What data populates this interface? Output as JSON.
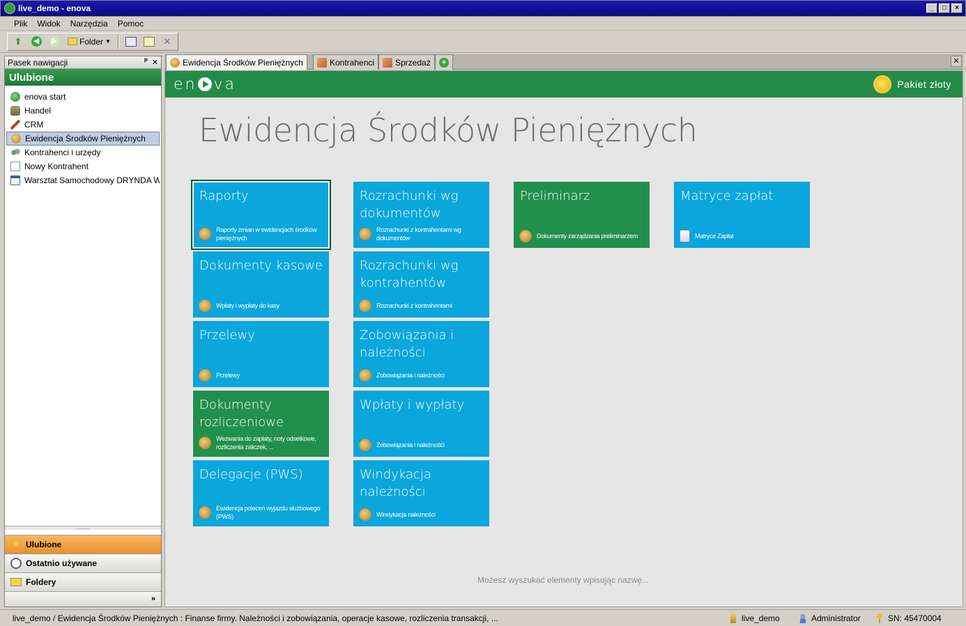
{
  "window": {
    "title": "live_demo - enova"
  },
  "menu": [
    "Plik",
    "Widok",
    "Narzędzia",
    "Pomoc"
  ],
  "toolbar": {
    "folder_label": "Folder"
  },
  "nav": {
    "header": "Pasek nawigacji",
    "title": "Ulubione",
    "items": [
      {
        "label": "enova start",
        "icon": "enova-globe-icon"
      },
      {
        "label": "Handel",
        "icon": "stack-icon"
      },
      {
        "label": "CRM",
        "icon": "phone-icon"
      },
      {
        "label": "Ewidencja Środków Pieniężnych",
        "icon": "coin-icon",
        "selected": true
      },
      {
        "label": "Kontrahenci i urzędy",
        "icon": "people-icon"
      },
      {
        "label": "Nowy Kontrahent",
        "icon": "document-icon"
      },
      {
        "label": "Warsztat Samochodowy DRYNDA Wi...",
        "icon": "window-icon"
      }
    ],
    "bottom": [
      {
        "label": "Ulubione",
        "icon": "star-icon",
        "active": true
      },
      {
        "label": "Ostatnio używane",
        "icon": "clock-icon"
      },
      {
        "label": "Foldery",
        "icon": "folder-icon"
      }
    ],
    "more": "»"
  },
  "tabs": [
    {
      "label": "Ewidencja Środków Pieniężnych",
      "icon": "coin-icon",
      "active": true
    },
    {
      "label": "Kontrahenci",
      "icon": "box-icon"
    },
    {
      "label": "Sprzedaż",
      "icon": "box-icon"
    },
    {
      "label": "",
      "icon": "add-tab-icon"
    }
  ],
  "header": {
    "logo": "enova",
    "package": "Pakiet złoty"
  },
  "page": {
    "title": "Ewidencja Środków Pieniężnych"
  },
  "tiles": [
    {
      "title": "Raporty",
      "desc": "Raporty zmian w ewidencjach środków pieniężnych",
      "color": "blue",
      "col": 0,
      "row": 0,
      "selected": true
    },
    {
      "title": "Dokumenty kasowe",
      "desc": "Wpłaty i wypłaty do kasy",
      "color": "blue",
      "col": 0,
      "row": 1
    },
    {
      "title": "Przelewy",
      "desc": "Przelewy",
      "color": "blue",
      "col": 0,
      "row": 2
    },
    {
      "title": "Dokumenty rozliczeniowe",
      "desc": "Wezwania do zapłaty, noty odsetkowe, rozliczenia zaliczek, ...",
      "color": "green",
      "col": 0,
      "row": 3
    },
    {
      "title": "Delegacje (PWS)",
      "desc": "Ewidencja poleceń wyjazdu służbowego (PWS)",
      "color": "blue",
      "col": 0,
      "row": 4
    },
    {
      "title": "Rozrachunki wg dokumentów",
      "desc": "Rozrachunki z kontrahentami wg dokumentów",
      "color": "blue",
      "col": 1,
      "row": 0
    },
    {
      "title": "Rozrachunki wg kontrahentów",
      "desc": "Rozrachunki z kontrahentami",
      "color": "blue",
      "col": 1,
      "row": 1
    },
    {
      "title": "Zobowiązania i należności",
      "desc": "Zobowiązania i należności",
      "color": "blue",
      "col": 1,
      "row": 2
    },
    {
      "title": "Wpłaty i wypłaty",
      "desc": "Zobowiązania i należności",
      "color": "blue",
      "col": 1,
      "row": 3
    },
    {
      "title": "Windykacja należności",
      "desc": "Windykacja należności",
      "color": "blue",
      "col": 1,
      "row": 4
    },
    {
      "title": "Preliminarz",
      "desc": "Dokumenty zarządzania preliminarzem",
      "color": "green",
      "col": 2,
      "row": 0
    },
    {
      "title": "Matryce zapłat",
      "desc": "Matryce Zapłat",
      "color": "blue",
      "col": 3,
      "row": 0,
      "icon": "docs"
    }
  ],
  "search_hint": "Możesz wyszukać elementy wpisując nazwę...",
  "status": {
    "path": "live_demo / Ewidencja Środków Pieniężnych : Finanse firmy. Należności i zobowiązania, operacje kasowe, rozliczenia transakcji, ...",
    "database": "live_demo",
    "user": "Administrator",
    "serial": "SN: 45470004"
  }
}
